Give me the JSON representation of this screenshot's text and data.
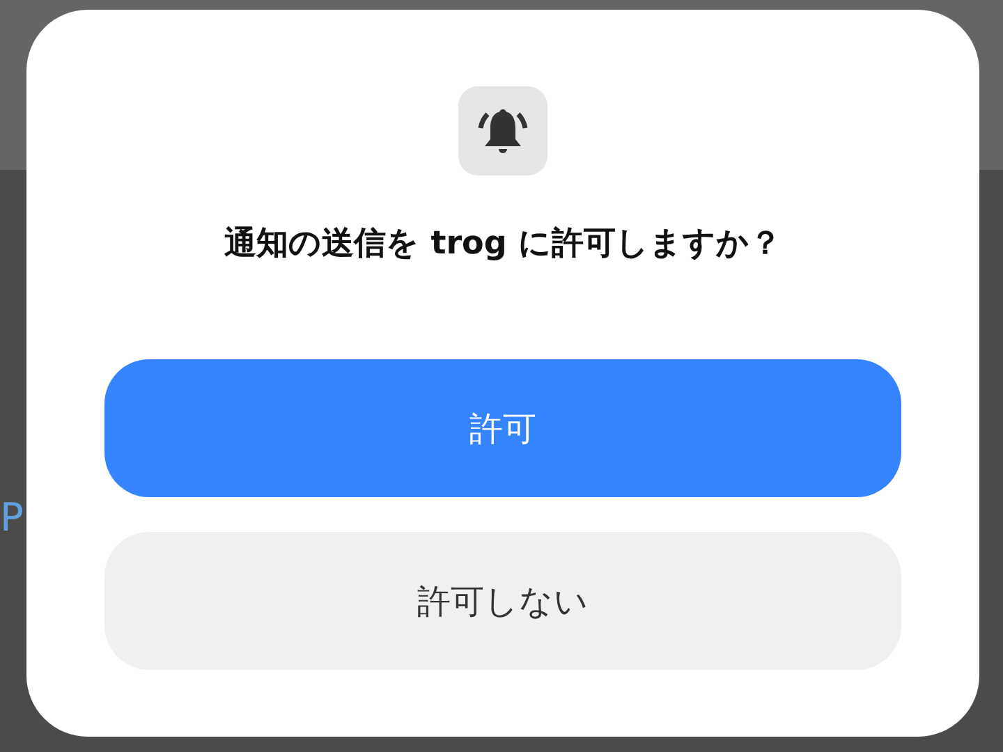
{
  "background": {
    "partial_text": "P"
  },
  "dialog": {
    "title": "通知の送信を trog に許可しますか？",
    "buttons": [
      {
        "label": "許可",
        "kind": "primary"
      },
      {
        "label": "許可しない",
        "kind": "secondary"
      }
    ]
  }
}
